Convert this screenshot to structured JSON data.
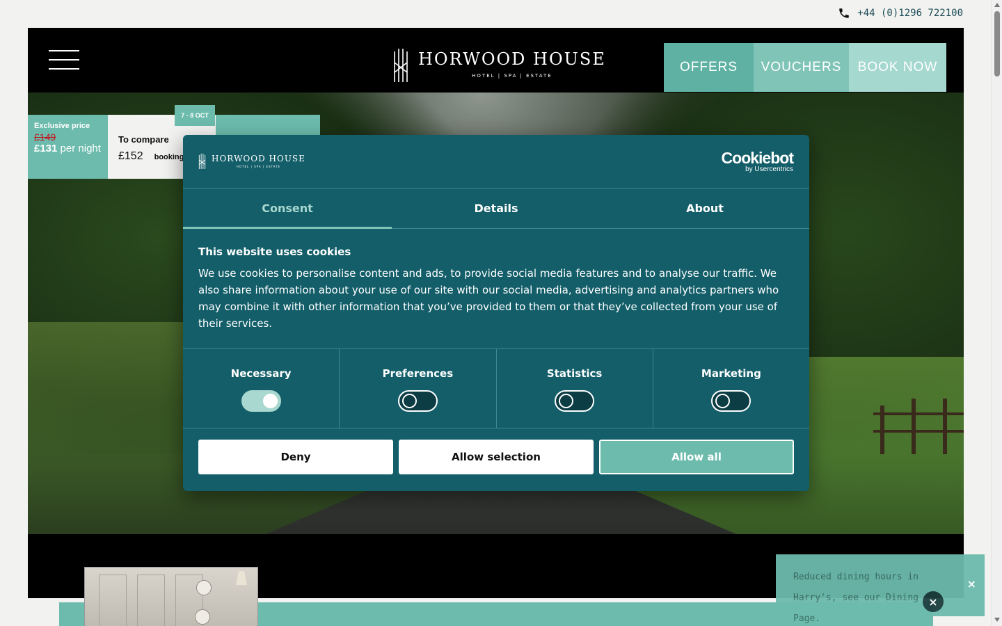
{
  "topbar": {
    "phone": "+44 (0)1296 722100",
    "phone_icon": "phone-icon"
  },
  "header": {
    "logo_name": "HORWOOD HOUSE",
    "logo_sub": "HOTEL  |  SPA  |  ESTATE",
    "nav": {
      "offers": "OFFERS",
      "vouchers": "VOUCHERS",
      "book": "BOOK NOW"
    },
    "menu_icon": "hamburger-menu-icon"
  },
  "price_widget": {
    "exclusive_label": "Exclusive price",
    "old_price": "£149",
    "new_price": "£131",
    "per_night": "per night",
    "date": "7 - 8 OCT",
    "compare_title": "To compare",
    "compare_price": "£152",
    "compare_site": "booking"
  },
  "cookie": {
    "logo_name": "HORWOOD HOUSE",
    "logo_sub": "HOTEL | SPA | ESTATE",
    "brand_name": "Cookiebot",
    "brand_sub": "by Usercentrics",
    "tabs": [
      "Consent",
      "Details",
      "About"
    ],
    "title": "This website uses cookies",
    "text": "We use cookies to personalise content and ads, to provide social media features and to analyse our traffic. We also share information about your use of our site with our social media, advertising and analytics partners who may combine it with other information that you’ve provided to them or that they’ve collected from your use of their services.",
    "categories": [
      {
        "label": "Necessary",
        "on": true
      },
      {
        "label": "Preferences",
        "on": false
      },
      {
        "label": "Statistics",
        "on": false
      },
      {
        "label": "Marketing",
        "on": false
      }
    ],
    "buttons": {
      "deny": "Deny",
      "allow_selection": "Allow selection",
      "allow_all": "Allow all"
    },
    "colors": {
      "background": "#135e69",
      "accent": "#6cbbac"
    }
  },
  "toast": {
    "text": "Reduced dining hours in Harry's, see our Dining Page.",
    "close": "×",
    "close_alt": "×"
  },
  "colors": {
    "brand": "#6cbbac",
    "phone_text": "#1d4d57",
    "old_price": "#c4141f"
  }
}
